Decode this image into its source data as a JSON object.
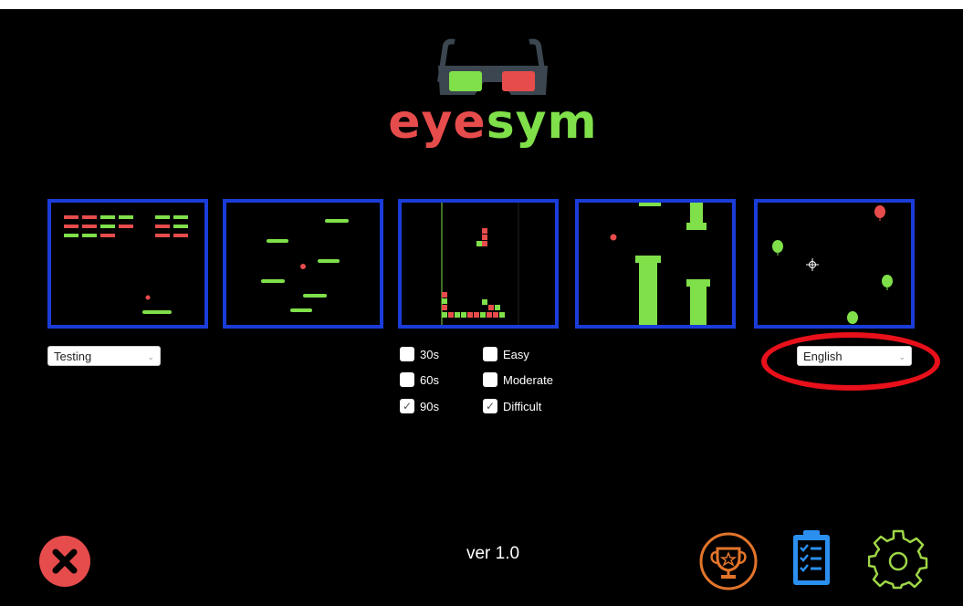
{
  "app": {
    "logo_part1": "eye",
    "logo_part2": "sym",
    "version": "ver 1.0"
  },
  "mode_select": {
    "value": "Testing"
  },
  "language_select": {
    "value": "English"
  },
  "durations": [
    {
      "label": "30s",
      "checked": false
    },
    {
      "label": "60s",
      "checked": false
    },
    {
      "label": "90s",
      "checked": true
    }
  ],
  "difficulties": [
    {
      "label": "Easy",
      "checked": false
    },
    {
      "label": "Moderate",
      "checked": false
    },
    {
      "label": "Difficult",
      "checked": true
    }
  ],
  "games": [
    "breakout-game",
    "jumper-game",
    "tetris-game",
    "flappy-game",
    "balloon-shooter-game"
  ],
  "colors": {
    "accent_red": "#e74c4c",
    "accent_green": "#7fe04a",
    "panel_border": "#1a3cd8",
    "highlight_ellipse": "#e8101a",
    "trophy": "#e3752a",
    "clipboard": "#2b8ff0",
    "gear": "#9ed646"
  },
  "icons": [
    "glasses-icon",
    "close-icon",
    "trophy-icon",
    "clipboard-icon",
    "gear-icon"
  ]
}
